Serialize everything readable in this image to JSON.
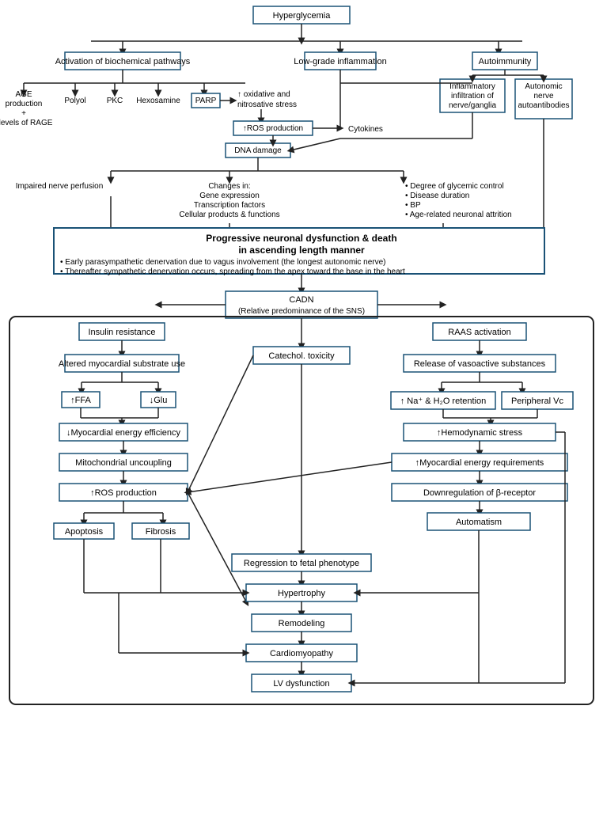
{
  "diagram": {
    "title": "Hyperglycemia",
    "nodes": {
      "hyperglycemia": "Hyperglycemia",
      "activation_biochemical": "Activation of biochemical pathways",
      "low_grade_inflammation": "Low-grade inflammation",
      "autoimmunity": "Autoimmunity",
      "age_production": "AGE\nproduction\n+\n↓levels of RAGE",
      "polyol": "Polyol",
      "pkc": "PKC",
      "hexosamine": "Hexosamine",
      "parp": "PARP",
      "oxidative_stress": "↑ oxidative and\nnitrosative stress",
      "ros_production": "↑ROS production",
      "cytokines": "Cytokines",
      "dna_damage": "DNA damage",
      "impaired_nerve": "Impaired nerve perfusion",
      "changes_in": "Changes in:\nGene expression\nTranscription factors\nCellular products & functions",
      "degree_glycemic": "• Degree of glycemic control\n• Disease duration\n• BP\n• Age-related neuronal attrition",
      "inflammatory": "Inflammatory\ninfiltration of\nnerve/ganglia",
      "autonomic_nerve": "Autonomic\nnerve\nautoantibodies",
      "progressive_neuronal": "Progressive neuronal dysfunction & death\nin ascending length manner",
      "progressive_bullet1": "• Early parasympathetic denervation due to vagus involvement (the longest autonomic nerve)",
      "progressive_bullet2": "• Thereafter sympathetic denervation occurs, spreading from the apex toward the base in the heart",
      "cadn": "CADN\n(Relative predominance of the SNS)",
      "insulin_resistance": "Insulin resistance",
      "raas_activation": "RAAS activation",
      "altered_myocardial": "Altered myocardial substrate use",
      "release_vasoactive": "Release of vasoactive substances",
      "ffa": "↑FFA",
      "glu": "↓Glu",
      "na_retention": "↑ Na⁺ & H₂O retention",
      "peripheral_vc": "Peripheral Vc",
      "myocardial_energy_efficiency": "↓Myocardial energy efficiency",
      "hemodynamic_stress": "↑Hemodynamic stress",
      "mitochondrial_uncoupling": "Mitochondrial uncoupling",
      "myocardial_energy_req": "↑Myocardial energy requirements",
      "ros_production2": "↑ROS production",
      "downregulation": "Downregulation of β-receptor",
      "apoptosis": "Apoptosis",
      "fibrosis": "Fibrosis",
      "catechol_toxicity": "Catechol. toxicity",
      "automatism": "Automatism",
      "regression_fetal": "Regression to fetal phenotype",
      "hypertrophy": "Hypertrophy",
      "remodeling": "Remodeling",
      "cardiomyopathy": "Cardiomyopathy",
      "lv_dysfunction": "LV dysfunction"
    }
  }
}
